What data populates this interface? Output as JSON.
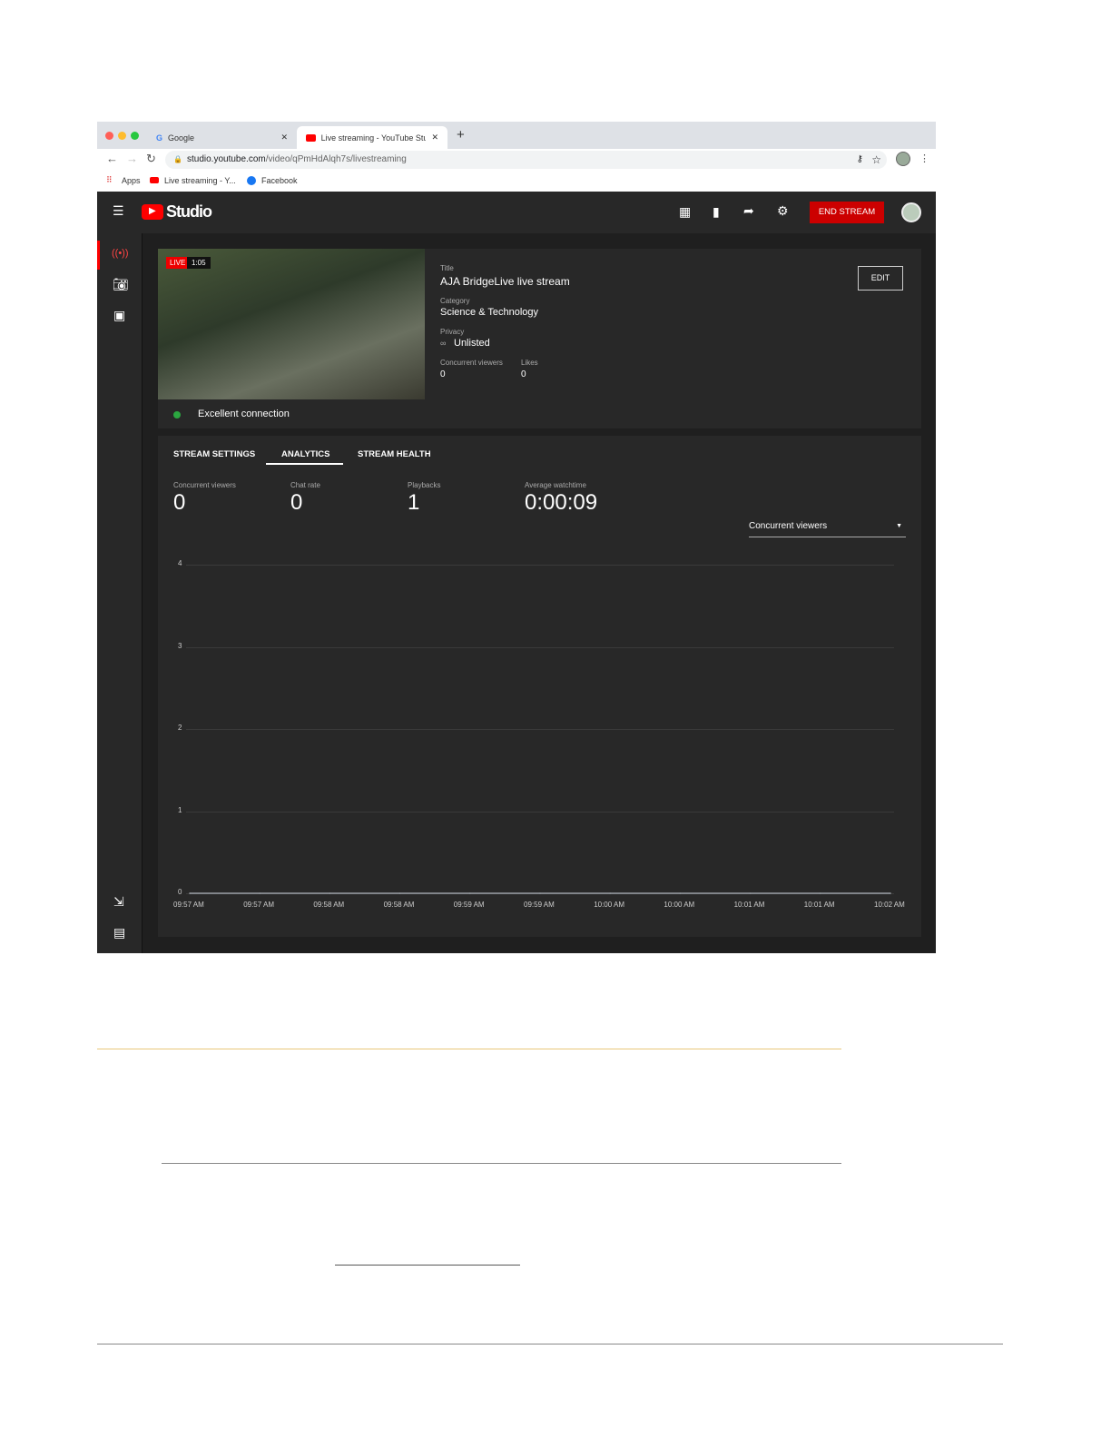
{
  "browser": {
    "tabs": [
      {
        "label": "Google",
        "icon": "google-icon"
      },
      {
        "label": "Live streaming - YouTube Stud",
        "icon": "youtube-icon"
      }
    ],
    "url_host": "studio.youtube.com",
    "url_path": "/video/qPmHdAlqh7s/livestreaming",
    "bookmarks": [
      "Apps",
      "Live streaming - Y...",
      "Facebook"
    ]
  },
  "header": {
    "logo": "Studio",
    "end_stream": "END STREAM",
    "icons": [
      "clapperboard-icon",
      "bookmark-icon",
      "share-icon",
      "gear-icon"
    ],
    "accent": "#cc0000"
  },
  "preview": {
    "live_badge": "LIVE",
    "duration": "1:05",
    "connection": "Excellent connection",
    "connection_color": "#2ba640"
  },
  "details": {
    "title_label": "Title",
    "title": "AJA BridgeLive live stream",
    "category_label": "Category",
    "category": "Science & Technology",
    "privacy_label": "Privacy",
    "privacy": "Unlisted",
    "viewers_label": "Concurrent viewers",
    "viewers": "0",
    "likes_label": "Likes",
    "likes": "0",
    "edit": "EDIT"
  },
  "tabs": [
    {
      "label": "STREAM SETTINGS"
    },
    {
      "label": "ANALYTICS",
      "active": true
    },
    {
      "label": "STREAM HEALTH"
    }
  ],
  "stats": [
    {
      "label": "Concurrent viewers",
      "value": "0"
    },
    {
      "label": "Chat rate",
      "value": "0"
    },
    {
      "label": "Playbacks",
      "value": "1"
    },
    {
      "label": "Average watchtime",
      "value": "0:00:09"
    }
  ],
  "metric_select": "Concurrent viewers",
  "chart_data": {
    "type": "line",
    "categories": [
      "09:57 AM",
      "09:57 AM",
      "09:58 AM",
      "09:58 AM",
      "09:59 AM",
      "09:59 AM",
      "10:00 AM",
      "10:00 AM",
      "10:01 AM",
      "10:01 AM",
      "10:02 AM"
    ],
    "values": [
      0,
      0,
      0,
      0,
      0,
      0,
      0,
      0,
      0,
      0,
      0
    ],
    "yticks": [
      "0",
      "1",
      "2",
      "3",
      "4"
    ],
    "ylim": [
      0,
      4
    ],
    "grid": true
  }
}
